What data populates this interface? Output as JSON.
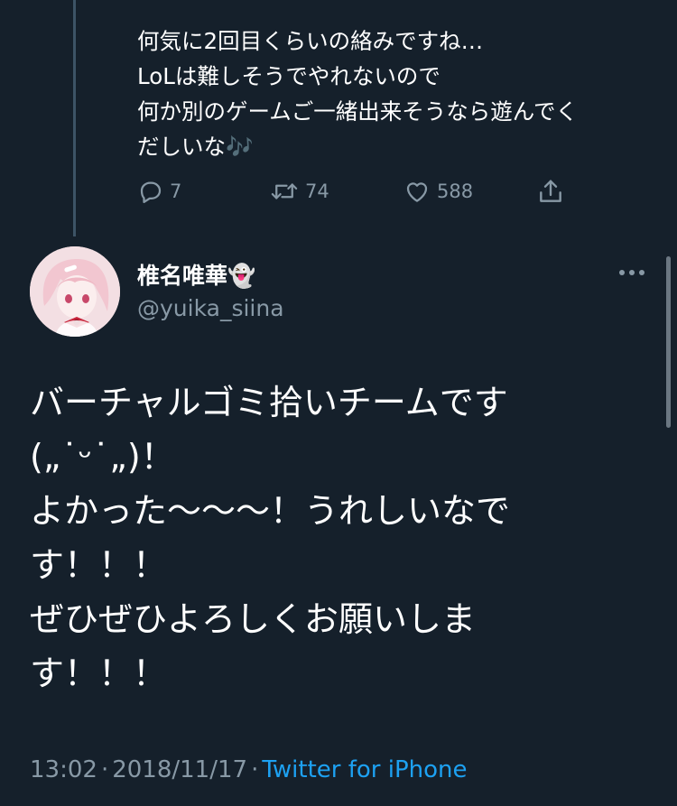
{
  "previous_tweet": {
    "text": "何気に2回目くらいの絡みですね…\nLoLは難しそうでやれないので\n何か別のゲームご一緒出来そうなら遊んでく\nだしいな🎶",
    "actions": {
      "reply": {
        "icon": "reply-icon",
        "count": "7"
      },
      "retweet": {
        "icon": "retweet-icon",
        "count": "74"
      },
      "like": {
        "icon": "heart-icon",
        "count": "588"
      },
      "share": {
        "icon": "share-icon"
      }
    }
  },
  "tweet": {
    "display_name": "椎名唯華👻",
    "handle": "@yuika_siina",
    "text": "バーチャルゴミ拾いチームです\n(„˙ᵕ˙„)！\nよかった〜〜〜！うれしいなで\nす！！！\nぜひぜひよろしくお願いしま\nす！！！",
    "time": "13:02",
    "date": "2018/11/17",
    "source": "Twitter for iPhone",
    "separator": "·"
  },
  "colors": {
    "background": "#15202b",
    "text": "#ffffff",
    "secondary": "#8899a6",
    "link": "#1da1f2",
    "thread_line": "#3d5466"
  }
}
